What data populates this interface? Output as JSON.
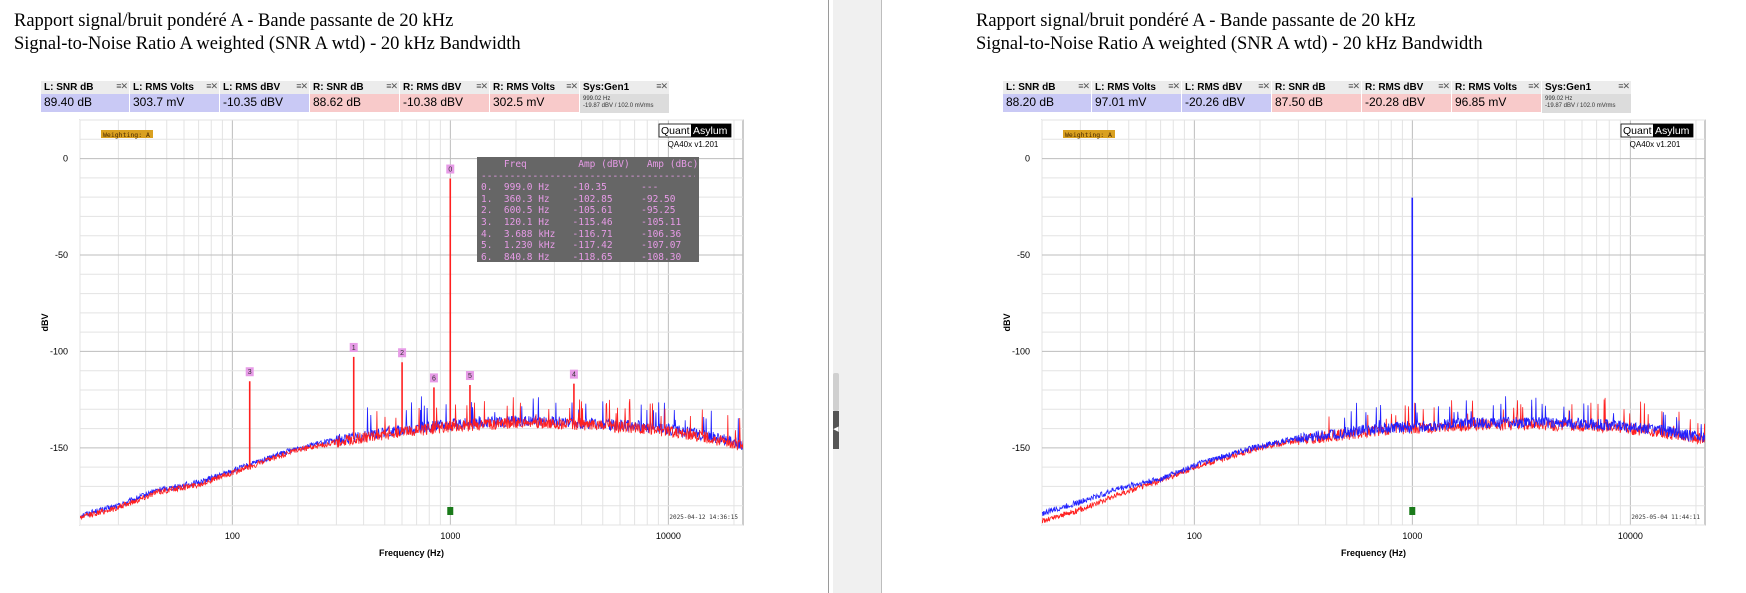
{
  "panels": [
    {
      "titles": [
        "Rapport signal/bruit pondéré A - Bande passante de 20 kHz",
        "Signal-to-Noise Ratio A weighted (SNR A wtd) - 20 kHz Bandwidth"
      ],
      "meters": [
        {
          "label": "L: SNR dB",
          "value": "89.40 dB",
          "channel": "L",
          "width": 88
        },
        {
          "label": "L: RMS Volts",
          "value": "303.7 mV",
          "channel": "L",
          "width": 89
        },
        {
          "label": "L: RMS dBV",
          "value": "-10.35 dBV",
          "channel": "L",
          "width": 89
        },
        {
          "label": "R: SNR dB",
          "value": "88.62 dB",
          "channel": "R",
          "width": 89
        },
        {
          "label": "R: RMS dBV",
          "value": "-10.38 dBV",
          "channel": "R",
          "width": 89
        },
        {
          "label": "R: RMS Volts",
          "value": "302.5 mV",
          "channel": "R",
          "width": 89
        },
        {
          "label": "Sys:Gen1",
          "value": "999.02 Hz",
          "value2": "-19.87 dBV / 102.0 mVrms",
          "channel": "G",
          "width": 89
        }
      ],
      "weighting": "Weighting: A",
      "brand_left": "Quant",
      "brand_right": "Asylum",
      "version": "QA40x v1.201",
      "timestamp": "2025-04-12 14:36:15",
      "show_table": true,
      "peak_table": {
        "header": "    Freq         Amp (dBV)   Amp (dBc)",
        "rows": [
          "0.  999.0 Hz    -10.35      ---",
          "1.  360.3 Hz    -102.85     -92.50",
          "2.  600.5 Hz    -105.61     -95.25",
          "3.  120.1 Hz    -115.46     -105.11",
          "4.  3.688 kHz   -116.71     -106.36",
          "5.  1.230 kHz   -117.42     -107.07",
          "6.  840.8 Hz    -118.65     -108.30"
        ]
      },
      "chart_data": {
        "type": "line",
        "title": "",
        "xlabel": "Frequency (Hz)",
        "ylabel": "dBV",
        "x_scale": "log",
        "xlim": [
          20,
          22000
        ],
        "ylim": [
          -190,
          20
        ],
        "x_ticks": [
          100,
          1000,
          10000
        ],
        "y_ticks": [
          0,
          -50,
          -100,
          -150
        ],
        "grid": true,
        "series": [
          {
            "channel": "L",
            "color": "#2020ff",
            "x": [
              20,
              30,
              45,
              70,
              100,
              150,
              200,
              300,
              500,
              700,
              1000,
              2000,
              4000,
              8000,
              14000,
              22000
            ],
            "y": [
              -185,
              -180,
              -172,
              -168,
              -162,
              -155,
              -150,
              -146,
              -142,
              -140,
              -138,
              -136,
              -137,
              -139,
              -143,
              -148
            ]
          },
          {
            "channel": "R",
            "color": "#ff2020",
            "x": [
              20,
              30,
              45,
              70,
              100,
              150,
              200,
              300,
              500,
              700,
              1000,
              2000,
              4000,
              8000,
              14000,
              22000
            ],
            "y": [
              -186,
              -181,
              -173,
              -169,
              -163,
              -156,
              -151,
              -147,
              -143,
              -141,
              -139,
              -137,
              -138,
              -140,
              -144,
              -149
            ]
          }
        ],
        "peaks": [
          {
            "x": 999.0,
            "y": -10.35,
            "label": "0"
          },
          {
            "x": 360.3,
            "y": -102.85,
            "label": "1"
          },
          {
            "x": 600.5,
            "y": -105.61,
            "label": "2"
          },
          {
            "x": 120.1,
            "y": -115.46,
            "label": "3"
          },
          {
            "x": 3688,
            "y": -116.71,
            "label": "4"
          },
          {
            "x": 1230,
            "y": -117.42,
            "label": "5"
          },
          {
            "x": 840.8,
            "y": -118.65,
            "label": "6"
          }
        ],
        "peak_color": "#ff2020",
        "marker_x": 999.0
      }
    },
    {
      "titles": [
        "Rapport signal/bruit pondéré A - Bande passante de 20 kHz",
        "Signal-to-Noise Ratio A weighted (SNR A wtd) - 20 kHz Bandwidth"
      ],
      "meters": [
        {
          "label": "L: SNR dB",
          "value": "88.20 dB",
          "channel": "L",
          "width": 88
        },
        {
          "label": "L: RMS Volts",
          "value": "97.01 mV",
          "channel": "L",
          "width": 89
        },
        {
          "label": "L: RMS dBV",
          "value": "-20.26 dBV",
          "channel": "L",
          "width": 89
        },
        {
          "label": "R: SNR dB",
          "value": "87.50 dB",
          "channel": "R",
          "width": 89
        },
        {
          "label": "R: RMS dBV",
          "value": "-20.28 dBV",
          "channel": "R",
          "width": 89
        },
        {
          "label": "R: RMS Volts",
          "value": "96.85 mV",
          "channel": "R",
          "width": 89
        },
        {
          "label": "Sys:Gen1",
          "value": "999.02 Hz",
          "value2": "-19.87 dBV / 102.0 mVrms",
          "channel": "G",
          "width": 89
        }
      ],
      "weighting": "Weighting: A",
      "brand_left": "Quant",
      "brand_right": "Asylum",
      "version": "QA40x v1.201",
      "timestamp": "2025-05-04 11:44:11",
      "show_table": false,
      "chart_data": {
        "type": "line",
        "title": "",
        "xlabel": "Frequency (Hz)",
        "ylabel": "dBV",
        "x_scale": "log",
        "xlim": [
          20,
          22000
        ],
        "ylim": [
          -190,
          20
        ],
        "x_ticks": [
          100,
          1000,
          10000
        ],
        "y_ticks": [
          0,
          -50,
          -100,
          -150
        ],
        "grid": true,
        "series": [
          {
            "channel": "R",
            "color": "#ff2020",
            "x": [
              20,
              30,
              45,
              70,
              100,
              150,
              200,
              300,
              500,
              700,
              1000,
              2000,
              4000,
              8000,
              14000,
              22000
            ],
            "y": [
              -188,
              -182,
              -174,
              -167,
              -160,
              -154,
              -150,
              -146,
              -143,
              -141,
              -140,
              -138,
              -138,
              -139,
              -142,
              -146
            ]
          },
          {
            "channel": "L",
            "color": "#2020ff",
            "x": [
              20,
              30,
              45,
              70,
              100,
              150,
              200,
              300,
              500,
              700,
              1000,
              2000,
              4000,
              8000,
              14000,
              22000
            ],
            "y": [
              -184,
              -178,
              -171,
              -166,
              -159,
              -153,
              -149,
              -145,
              -142,
              -140,
              -139,
              -137,
              -137,
              -138,
              -141,
              -145
            ]
          }
        ],
        "peaks": [
          {
            "x": 999.0,
            "y": -20.26,
            "label": ""
          }
        ],
        "peak_color": "#2020ff",
        "marker_x": 999.0
      }
    }
  ]
}
